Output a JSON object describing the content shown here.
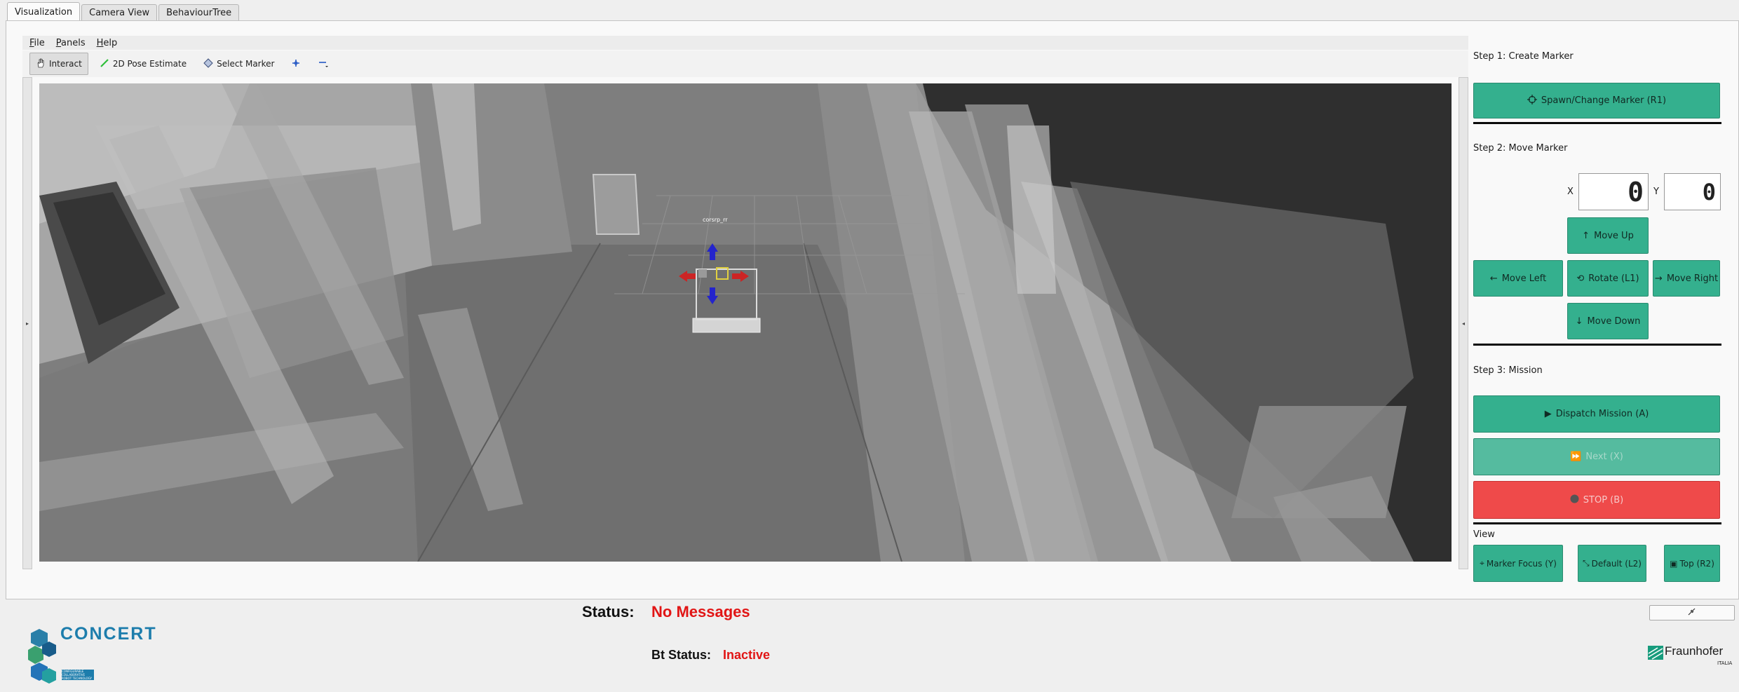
{
  "tabs": [
    {
      "label": "Visualization"
    },
    {
      "label": "Camera View"
    },
    {
      "label": "BehaviourTree"
    }
  ],
  "menu": {
    "file": "File",
    "panels": "Panels",
    "help": "Help"
  },
  "toolbar": {
    "interact": "Interact",
    "pose_estimate": "2D Pose Estimate",
    "select_marker": "Select Marker"
  },
  "viewport": {
    "marker_label": "corsrp_rr"
  },
  "panel": {
    "step1": "Step 1: Create Marker",
    "spawn": "Spawn/Change Marker (R1)",
    "step2": "Step 2:  Move Marker",
    "x_label": "X",
    "y_label": "Y",
    "x_value": "0",
    "y_value": "0",
    "move_up": "Move Up",
    "move_left": "Move Left",
    "rotate": "Rotate (L1)",
    "move_right": "Move Right",
    "move_down": "Move Down",
    "step3": "Step 3: Mission",
    "dispatch": "Dispatch Mission (A)",
    "next": "Next (X)",
    "stop": "STOP (B)",
    "view_label": "View",
    "marker_focus": "Marker Focus (Y)",
    "default_view": "Default (L2)",
    "top_view": "Top (R2)"
  },
  "status": {
    "label": "Status:",
    "value": "No Messages",
    "bt_label": "Bt Status:",
    "bt_value": "Inactive"
  },
  "logos": {
    "concert_text": "CONCERT",
    "concert_tagline": "CONFIGURABLE COLLABORATIVE ROBOT TECHNOLOGY",
    "fraunhofer": "Fraunhofer",
    "fraunhofer_sub": "ITALIA"
  },
  "colors": {
    "button_green": "#34b08e",
    "stop_red": "#ef4a4a",
    "status_red": "#e11515"
  }
}
